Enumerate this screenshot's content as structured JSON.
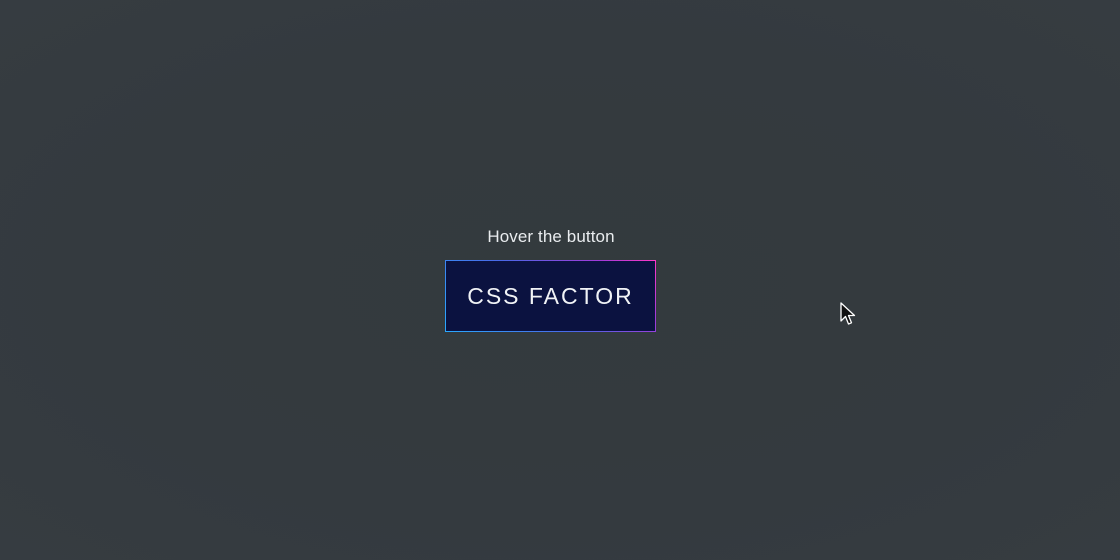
{
  "page": {
    "hint_text": "Hover the button",
    "button_label": "CSS FACTOR"
  },
  "colors": {
    "background": "#343a3f",
    "button_fill": "#0b1240",
    "gradient_start": "#2aa9ff",
    "gradient_end": "#ff38c8",
    "text": "#e9ecef"
  },
  "icons": {
    "cursor": "mouse-pointer-icon"
  }
}
